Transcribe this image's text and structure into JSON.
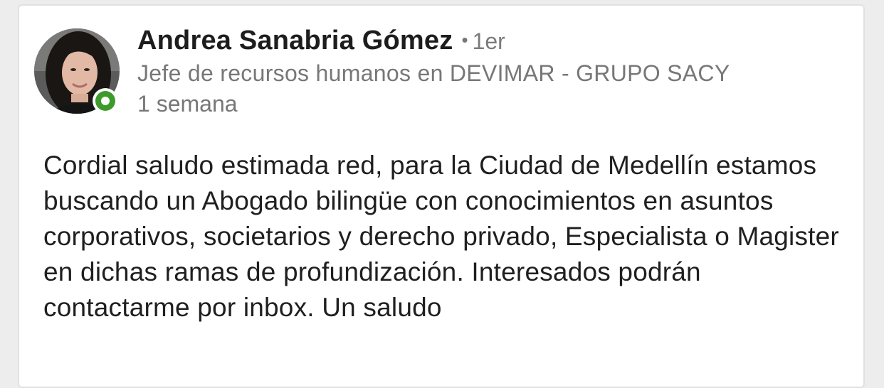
{
  "post": {
    "author": {
      "name": "Andrea Sanabria Gómez",
      "separator": "•",
      "degree": "1er",
      "headline": "Jefe de recursos humanos en DEVIMAR - GRUPO SACY",
      "online_status_color": "#3d9b2b"
    },
    "timestamp": "1 semana",
    "text": "Cordial saludo estimada red, para la Ciudad de Medellín estamos buscando un Abogado bilingüe con conocimientos en asuntos corporativos, societarios y derecho privado, Especialista o Magister en dichas ramas de profundización. Interesados podrán contactarme por inbox. Un saludo"
  }
}
